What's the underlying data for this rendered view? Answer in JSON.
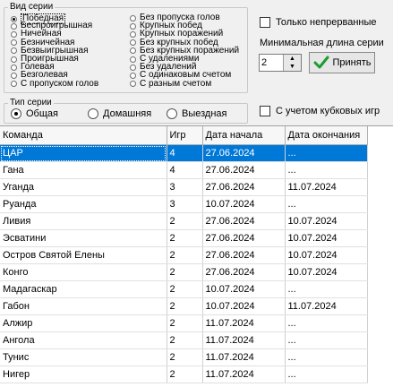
{
  "series_kind": {
    "legend": "Вид серии",
    "left_options": [
      "Победная",
      "Беспроигрышная",
      "Ничейная",
      "Безничейная",
      "Безвыигрышная",
      "Проигрышная",
      "Голевая",
      "Безголевая",
      "С пропуском голов"
    ],
    "right_options": [
      "Без пропуска голов",
      "Крупных побед",
      "Крупных поражений",
      "Без крупных побед",
      "Без крупных поражений",
      "С удалениями",
      "Без удалений",
      "С одинаковым счетом",
      "С разным счетом"
    ],
    "selected": "Победная"
  },
  "only_continuous": {
    "label": "Только непрерванные",
    "checked": false
  },
  "min_length": {
    "label": "Минимальная длина серии",
    "value": "2"
  },
  "apply_button": {
    "label": "Принять"
  },
  "series_type": {
    "legend": "Тип серии",
    "options": [
      "Общая",
      "Домашняя",
      "Выездная"
    ],
    "selected": "Общая"
  },
  "cup_games": {
    "label": "С учетом кубковых игр",
    "checked": false
  },
  "grid": {
    "columns": [
      "Команда",
      "Игр",
      "Дата начала",
      "Дата окончания"
    ],
    "selected_row": 0,
    "rows": [
      [
        "ЦАР",
        "4",
        "27.06.2024",
        "..."
      ],
      [
        "Гана",
        "4",
        "27.06.2024",
        "..."
      ],
      [
        "Уганда",
        "3",
        "27.06.2024",
        "11.07.2024"
      ],
      [
        "Руанда",
        "3",
        "10.07.2024",
        "..."
      ],
      [
        "Ливия",
        "2",
        "27.06.2024",
        "10.07.2024"
      ],
      [
        "Эсватини",
        "2",
        "27.06.2024",
        "10.07.2024"
      ],
      [
        "Остров Святой Елены",
        "2",
        "27.06.2024",
        "10.07.2024"
      ],
      [
        "Конго",
        "2",
        "27.06.2024",
        "10.07.2024"
      ],
      [
        "Мадагаскар",
        "2",
        "10.07.2024",
        "..."
      ],
      [
        "Габон",
        "2",
        "10.07.2024",
        "11.07.2024"
      ],
      [
        "Алжир",
        "2",
        "11.07.2024",
        "..."
      ],
      [
        "Ангола",
        "2",
        "11.07.2024",
        "..."
      ],
      [
        "Тунис",
        "2",
        "11.07.2024",
        "..."
      ],
      [
        "Нигер",
        "2",
        "11.07.2024",
        "..."
      ]
    ]
  }
}
